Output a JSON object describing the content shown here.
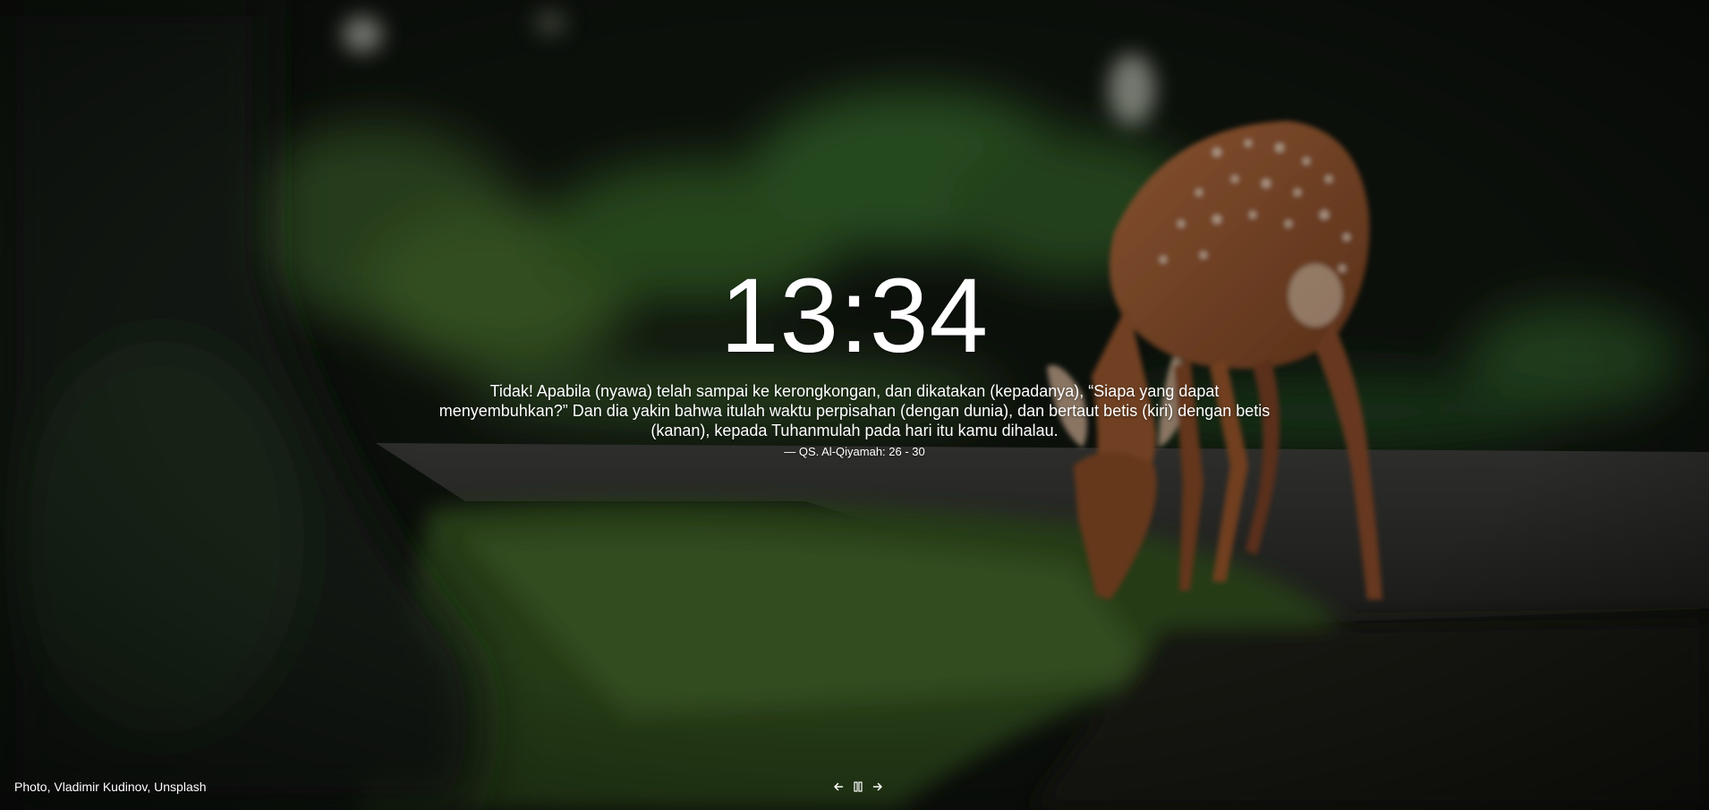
{
  "clock": {
    "time": "13:34"
  },
  "quote": {
    "text": "Tidak! Apabila (nyawa) telah sampai ke kerongkongan, dan dikatakan (kepadanya), “Siapa yang dapat menyembuhkan?” Dan dia yakin bahwa itulah waktu perpisahan (dengan dunia), dan bertaut betis (kiri) dengan betis (kanan), kepada Tuhanmulah pada hari itu kamu dihalau.",
    "source": "— QS. Al-Qiyamah: 26 - 30"
  },
  "photo": {
    "credit": "Photo, Vladimir Kudinov, Unsplash"
  },
  "controls": {
    "previous_icon": "arrow-left-icon",
    "pause_icon": "pause-icon",
    "next_icon": "arrow-right-icon"
  },
  "colors": {
    "text": "#ffffff",
    "background": "#0e120d"
  }
}
